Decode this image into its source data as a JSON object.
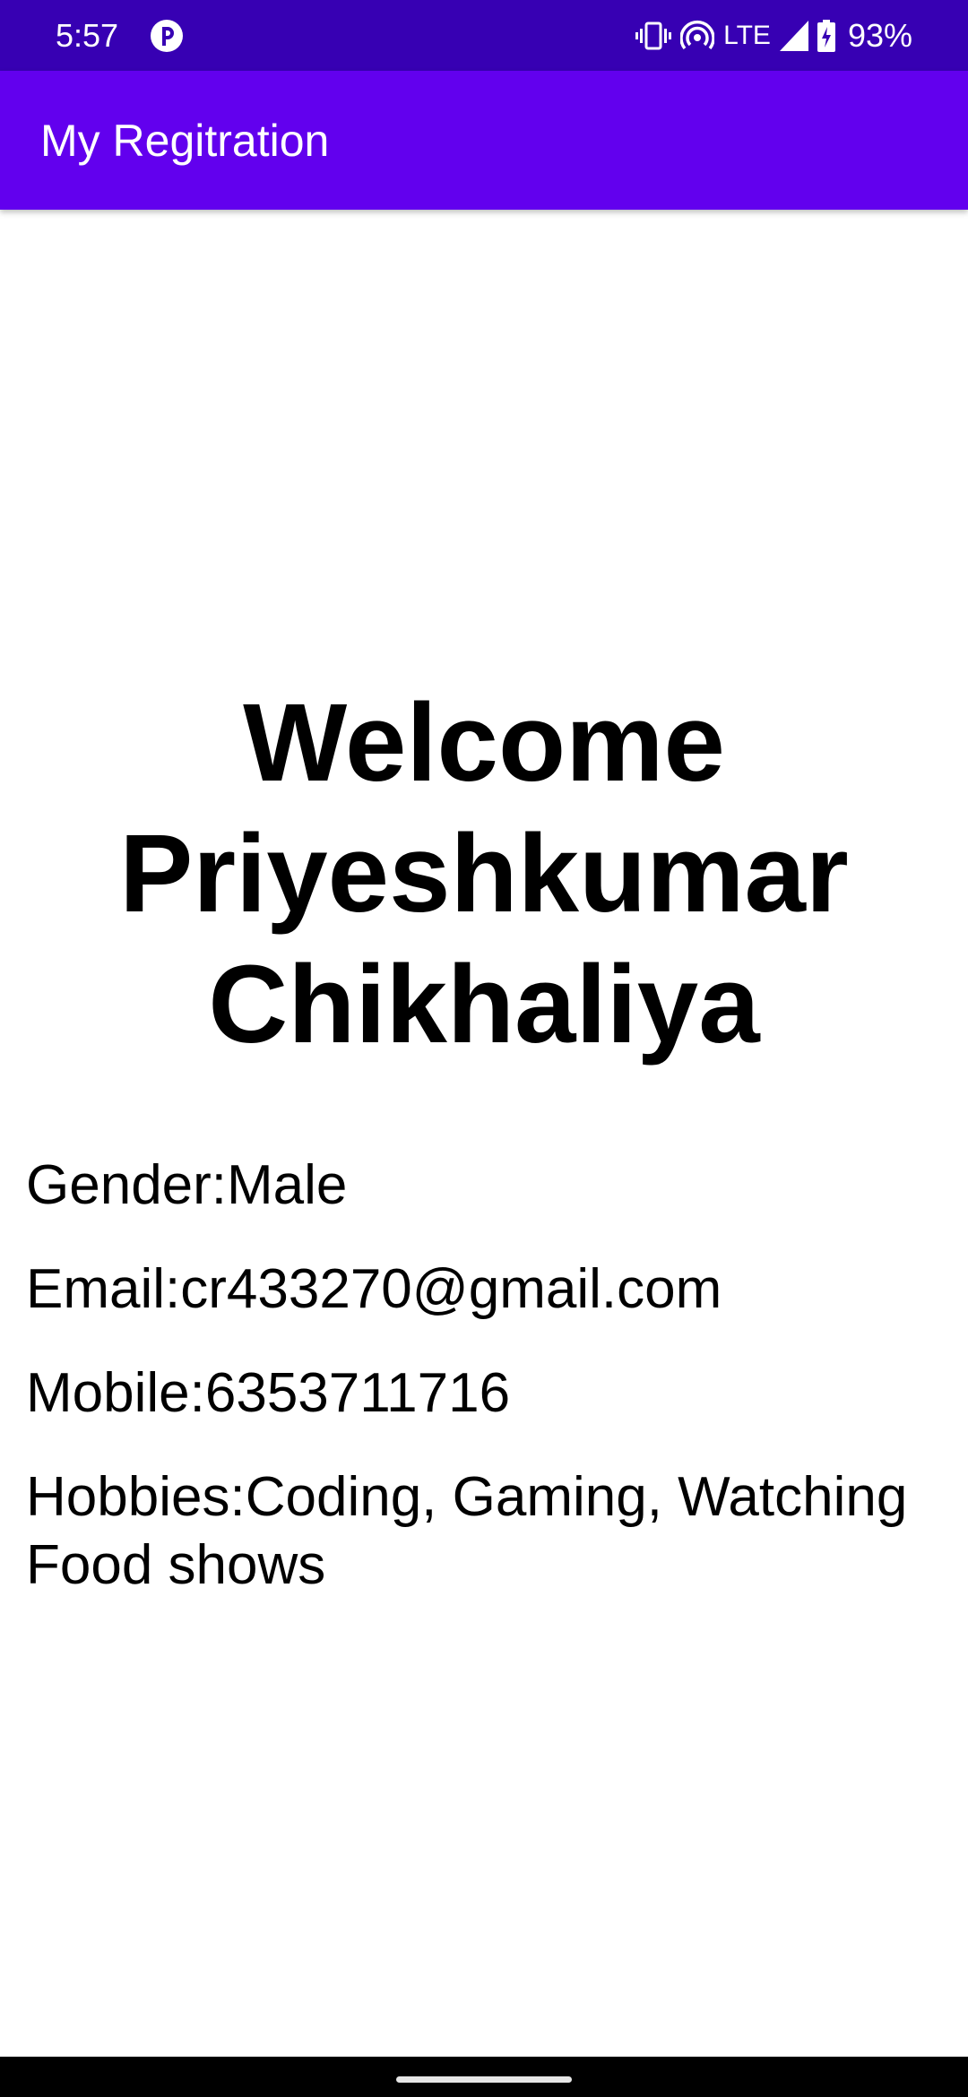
{
  "status_bar": {
    "time": "5:57",
    "network_type": "LTE",
    "battery_percent": "93%",
    "icons": [
      "app-notification-icon",
      "vibrate-icon",
      "hotspot-icon",
      "signal-icon",
      "battery-charging-icon"
    ]
  },
  "app_bar": {
    "title": "My Regitration",
    "color": "#6200ee",
    "status_color": "#3700b3"
  },
  "welcome": {
    "line1": "Welcome",
    "line2": "Priyeshkumar",
    "line3": "Chikhaliya"
  },
  "details": {
    "gender": "Gender:Male",
    "email": "Email:cr433270@gmail.com",
    "mobile": "Mobile:6353711716",
    "hobbies_line1": "Hobbies:Coding, Gaming, Watching",
    "hobbies_line2": "Food shows"
  }
}
